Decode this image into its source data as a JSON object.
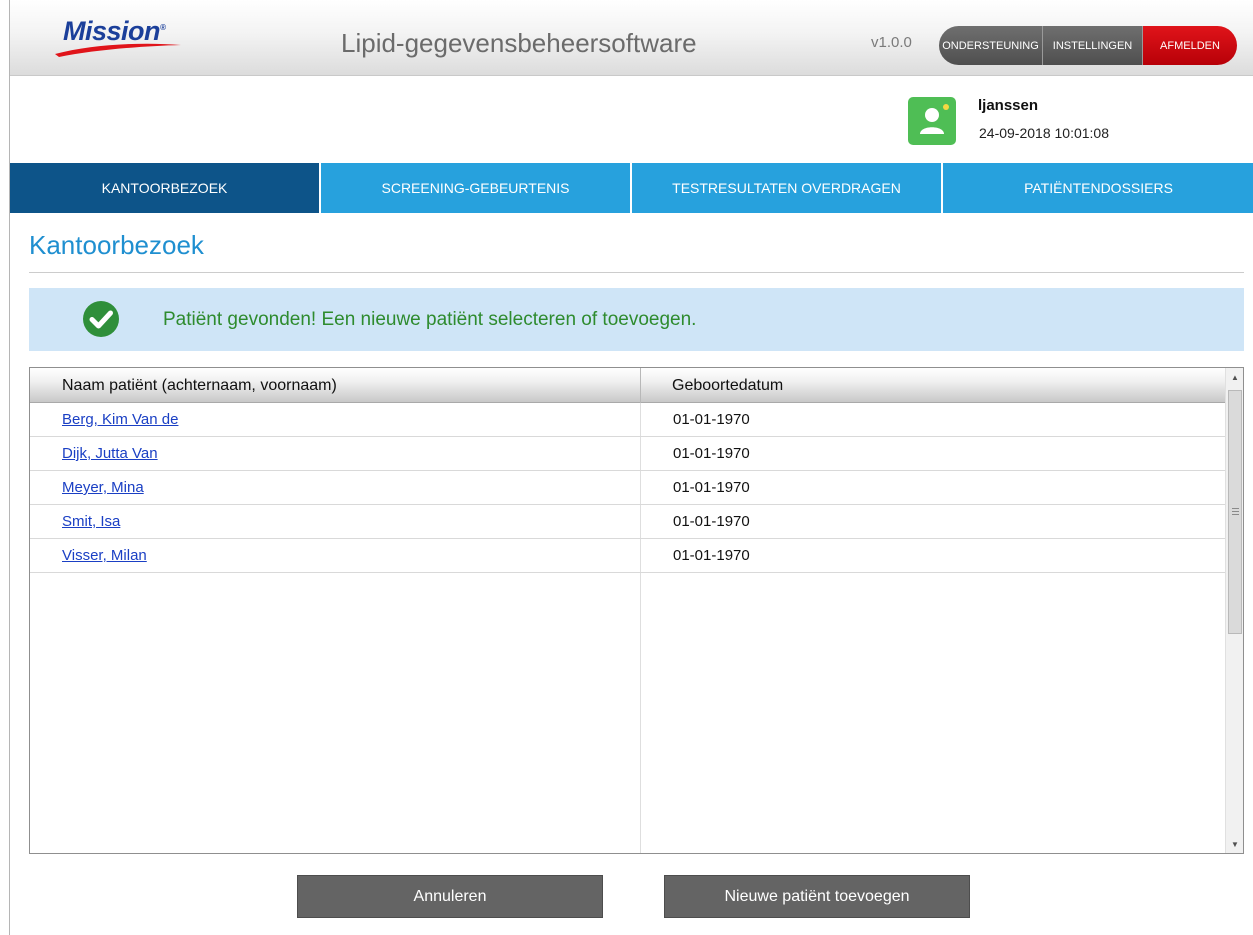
{
  "header": {
    "logo_text": "Mission",
    "logo_mark": "®",
    "app_title": "Lipid-gegevensbeheersoftware",
    "version": "v1.0.0",
    "buttons": {
      "support": "ONDERSTEUNING",
      "settings": "INSTELLINGEN",
      "logout": "AFMELDEN"
    },
    "colors": {
      "logout": "#cc0000",
      "logo": "#1b3f9a"
    }
  },
  "user": {
    "avatar_icon": "user-icon",
    "name": "ljanssen",
    "datetime": "24-09-2018 10:01:08"
  },
  "nav": {
    "tabs": [
      {
        "label": "KANTOORBEZOEK",
        "active": true
      },
      {
        "label": "SCREENING-GEBEURTENIS",
        "active": false
      },
      {
        "label": "TESTRESULTATEN OVERDRAGEN",
        "active": false
      },
      {
        "label": "PATIËNTENDOSSIERS",
        "active": false
      }
    ],
    "colors": {
      "active": "#0d5489",
      "inactive": "#27a1dd"
    }
  },
  "page": {
    "title": "Kantoorbezoek"
  },
  "alert": {
    "icon": "check-circle-icon",
    "message": "Patiënt gevonden! Een nieuwe patiënt selecteren of toevoegen.",
    "color": "#2e8b2e"
  },
  "table": {
    "headers": [
      "Naam patiënt (achternaam, voornaam)",
      "Geboortedatum"
    ],
    "rows": [
      {
        "name": "Berg, Kim Van de",
        "dob": "01-01-1970"
      },
      {
        "name": "Dijk, Jutta Van",
        "dob": "01-01-1970"
      },
      {
        "name": "Meyer, Mina",
        "dob": "01-01-1970"
      },
      {
        "name": "Smit, Isa",
        "dob": "01-01-1970"
      },
      {
        "name": "Visser, Milan",
        "dob": "01-01-1970"
      }
    ]
  },
  "actions": {
    "cancel": "Annuleren",
    "add_patient": "Nieuwe patiënt toevoegen"
  }
}
